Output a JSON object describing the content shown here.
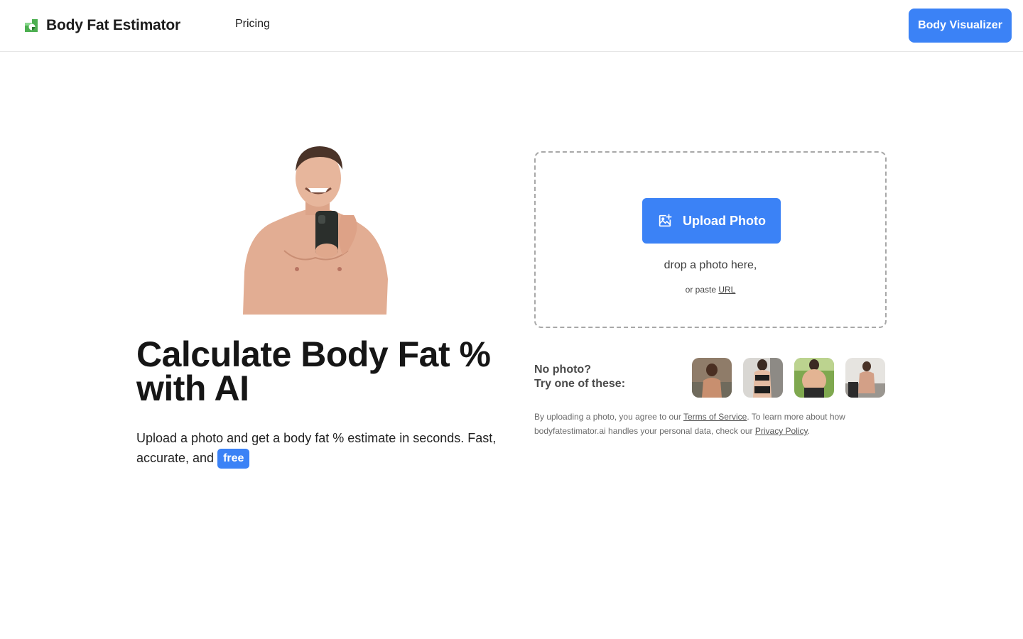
{
  "nav": {
    "brand": "Body Fat Estimator",
    "links": [
      "Pricing"
    ],
    "cta": "Body Visualizer"
  },
  "hero": {
    "title": "Calculate Body Fat % with AI",
    "subtitle": "Upload a photo and get a body fat % estimate in seconds. Fast, accurate, and",
    "badge": "free"
  },
  "upload": {
    "button": "Upload Photo",
    "drop_text": "drop a photo here,",
    "paste_prefix": "or paste",
    "paste_link": "URL"
  },
  "samples": {
    "label_line1": "No photo?",
    "label_line2": "Try one of these:"
  },
  "legal": {
    "part1": "By uploading a photo, you agree to our",
    "terms": "Terms of Service",
    "part2": ". To learn more about how bodyfatestimator.ai handles your personal data, check our",
    "privacy": "Privacy Policy",
    "part3": "."
  },
  "colors": {
    "accent": "#3b82f6",
    "logo_green": "#4caf50"
  },
  "icons": {
    "brand": "brand-logo-icon",
    "upload": "image-upload-icon"
  }
}
